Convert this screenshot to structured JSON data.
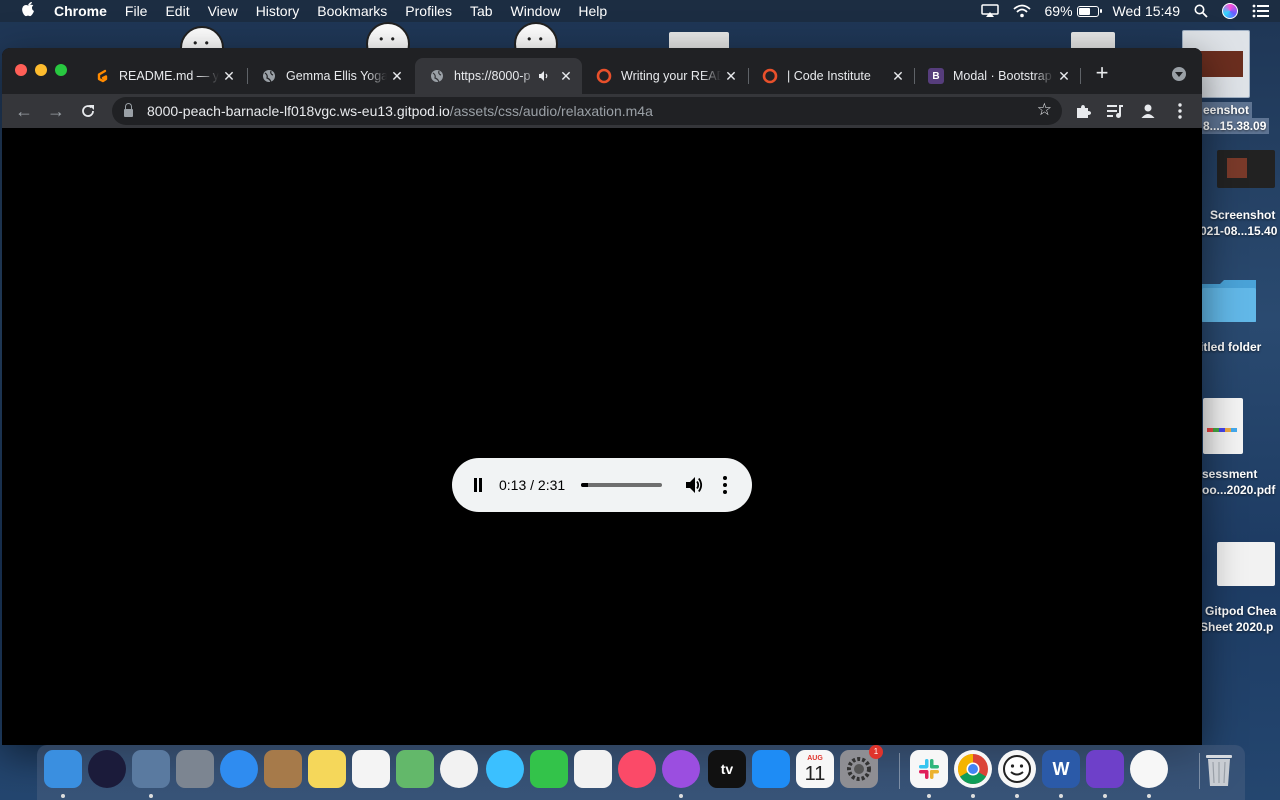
{
  "menubar": {
    "app_name": "Chrome",
    "menus": [
      "File",
      "Edit",
      "View",
      "History",
      "Bookmarks",
      "Profiles",
      "Tab",
      "Window",
      "Help"
    ],
    "battery": "69%",
    "battery_level": 0.69,
    "clock": "Wed 15:49",
    "icons": [
      "apple-icon",
      "airplay-icon",
      "wifi-icon",
      "battery-charging-icon",
      "search-icon",
      "siri-icon",
      "control-center-icon"
    ]
  },
  "desktop": {
    "items": [
      {
        "label1": "eenshot",
        "label2": "8...15.38.09"
      },
      {
        "label1": "Screenshot",
        "label2": "021-08...15.40"
      },
      {
        "label1": "itled folder",
        "label2": ""
      },
      {
        "label1": "sessment",
        "label2": "oo...2020.pdf"
      },
      {
        "label1": "Gitpod Chea",
        "label2": "Sheet 2020.p"
      }
    ]
  },
  "browser": {
    "tabs": [
      {
        "title": "README.md — yo",
        "favicon": "gitpod-icon",
        "color": "#ff8a00",
        "active": false
      },
      {
        "title": "Gemma Ellis Yoga",
        "favicon": "globe-icon",
        "color": "#9aa0a6",
        "active": false
      },
      {
        "title": "https://8000-p",
        "favicon": "globe-icon",
        "color": "#9aa0a6",
        "active": true,
        "audio": true
      },
      {
        "title": "Writing your READ",
        "favicon": "code-institute-icon",
        "color": "#e8502b",
        "active": false
      },
      {
        "title": "| Code Institute",
        "favicon": "code-institute-icon",
        "color": "#e8502b",
        "active": false
      },
      {
        "title": "Modal · Bootstrap",
        "favicon": "bootstrap-icon",
        "color": "#563d7c",
        "active": false
      }
    ],
    "url_host": "8000-peach-barnacle-lf018vgc.ws-eu13.gitpod.io",
    "url_path": "/assets/css/audio/relaxation.m4a",
    "new_tab": "+"
  },
  "player": {
    "current_time": "0:13",
    "separator": " / ",
    "duration": "2:31",
    "progress": 0.086
  },
  "dock": {
    "apps": [
      {
        "name": "finder-icon",
        "color": "#3a8fe0"
      },
      {
        "name": "siri-icon",
        "color": "#1b1b3a"
      },
      {
        "name": "mail-stamp-icon",
        "color": "#5a7aa0"
      },
      {
        "name": "launchpad-icon",
        "color": "#7c8591"
      },
      {
        "name": "safari-icon",
        "color": "#2f8cf0"
      },
      {
        "name": "contacts-icon",
        "color": "#a67a4a"
      },
      {
        "name": "notes-icon",
        "color": "#f5d75a"
      },
      {
        "name": "reminders-icon",
        "color": "#f4f4f4"
      },
      {
        "name": "maps-icon",
        "color": "#63b86a"
      },
      {
        "name": "photos-icon",
        "color": "#f2f2f2"
      },
      {
        "name": "messages-icon",
        "color": "#3bc0ff"
      },
      {
        "name": "facetime-icon",
        "color": "#33c34a"
      },
      {
        "name": "news-icon",
        "color": "#f2f2f2"
      },
      {
        "name": "music-icon",
        "color": "#fb4a68"
      },
      {
        "name": "podcasts-icon",
        "color": "#9b4ee0"
      },
      {
        "name": "apple-tv-icon",
        "color": "#111111"
      },
      {
        "name": "app-store-icon",
        "color": "#1e8cf5"
      },
      {
        "name": "calendar-icon",
        "color": "#f7f7f7"
      },
      {
        "name": "system-preferences-icon",
        "color": "#8e8e93"
      },
      {
        "name": "slack-icon",
        "color": "#f7f7f7"
      },
      {
        "name": "chrome-icon",
        "color": "#f7f7f7"
      },
      {
        "name": "face-app-icon",
        "color": "#f7f7f7"
      },
      {
        "name": "word-icon",
        "color": "#2b5aa8"
      },
      {
        "name": "github-desktop-icon",
        "color": "#6e40c9"
      },
      {
        "name": "messenger-icon",
        "color": "#f7f7f7"
      },
      {
        "name": "trash-icon",
        "color": "#c8ccd2"
      }
    ],
    "calendar_month": "AUG",
    "calendar_day": "11",
    "tv_label": "tv",
    "word_label": "W",
    "prefs_badge": "1"
  }
}
